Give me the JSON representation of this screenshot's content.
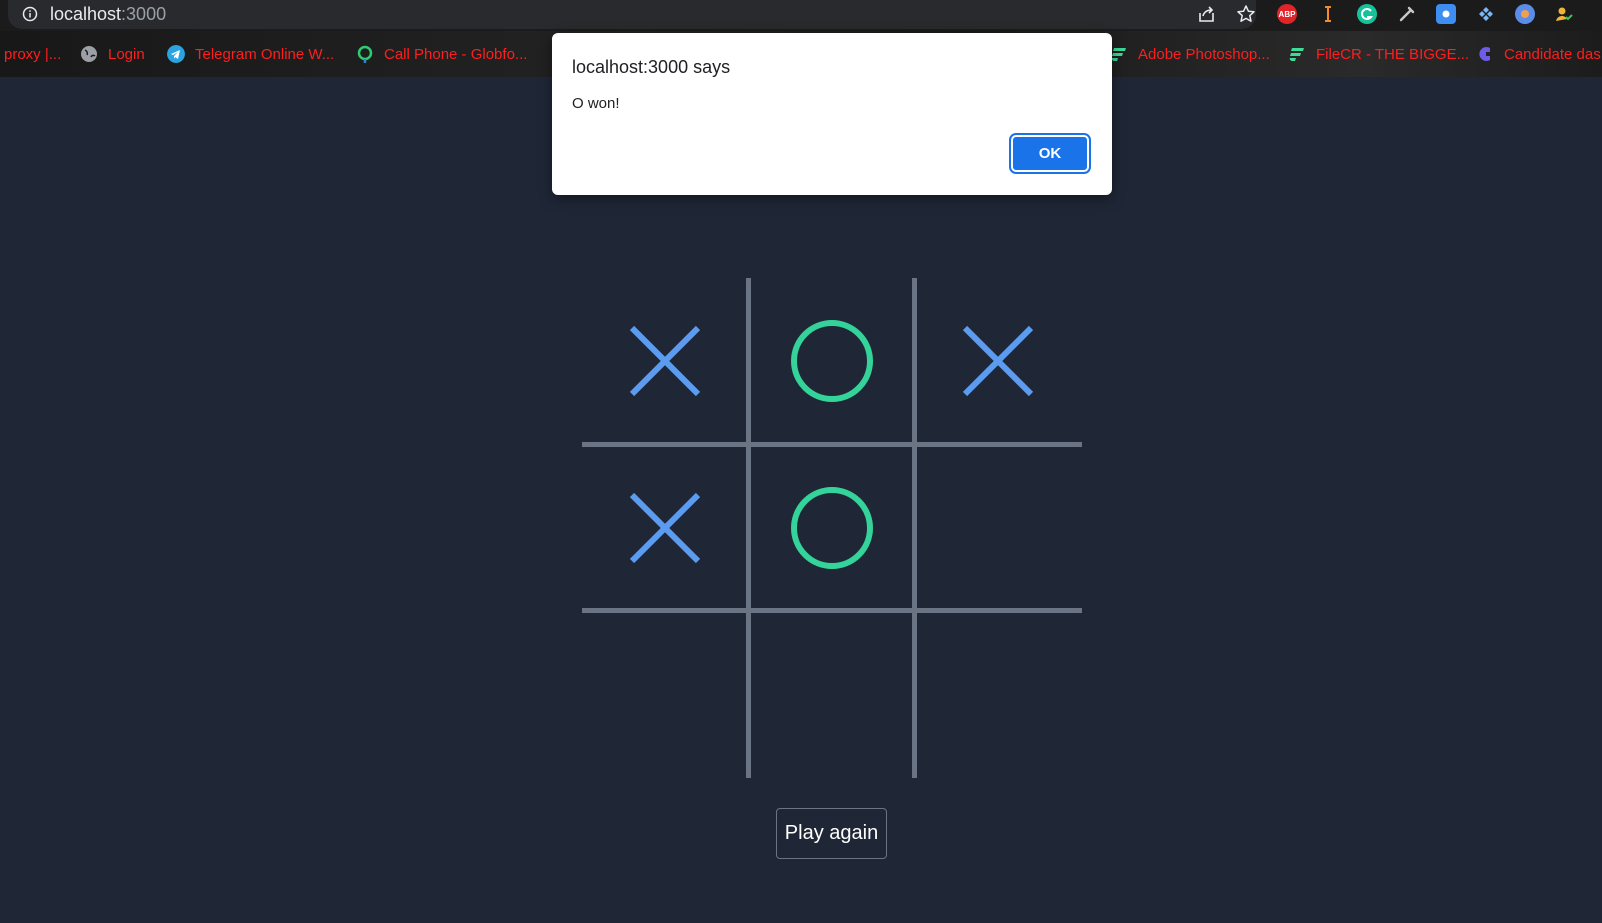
{
  "browser": {
    "url_host": "localhost",
    "url_port": ":3000",
    "bookmarks": [
      {
        "label": "proxy |...",
        "icon": "proxy-icon"
      },
      {
        "label": "Login",
        "icon": "globe-icon"
      },
      {
        "label": "Telegram Online W...",
        "icon": "telegram-icon"
      },
      {
        "label": "Call Phone - Globfo...",
        "icon": "globfone-icon"
      },
      {
        "label": "Adobe Photoshop...",
        "icon": "filecr-icon"
      },
      {
        "label": "FileCR - THE BIGGE...",
        "icon": "filecr-icon"
      },
      {
        "label": "Candidate das",
        "icon": "candidate-icon"
      }
    ],
    "extensions": [
      "share-icon",
      "star-icon",
      "adblock-icon",
      "cursor-extension-icon",
      "grammarly-icon",
      "eyedropper-icon",
      "screenshot-icon",
      "puzzle-extension-icon",
      "circle-extension-icon",
      "profile-extension-icon"
    ],
    "adblock_label": "ABP",
    "colors": {
      "bookmark_text": "#ff1e1e",
      "toolbar_bg": "#292a2d"
    }
  },
  "alert": {
    "title": "localhost:3000 says",
    "message": "O won!",
    "ok_label": "OK"
  },
  "game": {
    "board": [
      [
        "X",
        "O",
        "X"
      ],
      [
        "X",
        "O",
        ""
      ],
      [
        "",
        "",
        ""
      ]
    ],
    "play_again_label": "Play again",
    "colors": {
      "x": "#5b9cf0",
      "o": "#34d399",
      "grid": "#6b7484",
      "background": "#1f2737"
    }
  }
}
